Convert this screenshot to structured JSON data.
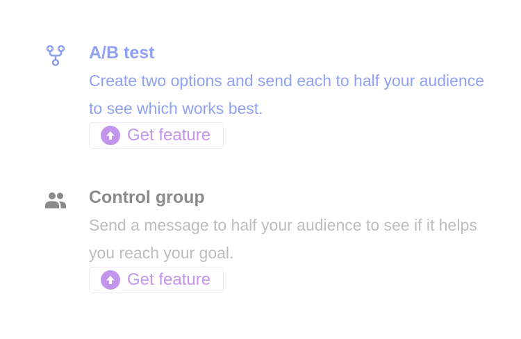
{
  "colors": {
    "accent_blue": "#8fa1f2",
    "accent_purple": "#c394ec",
    "title_gray": "#8a8a8a",
    "desc_gray": "#bdbdbd"
  },
  "features": [
    {
      "icon": "fork-icon",
      "title": "A/B test",
      "description": "Create two options and send each to half your audience to see which works best.",
      "button_label": "Get feature",
      "button_icon": "upgrade-arrow-icon"
    },
    {
      "icon": "people-icon",
      "title": "Control group",
      "description": "Send a message to half your audience to see if it helps you reach your goal.",
      "button_label": "Get feature",
      "button_icon": "upgrade-arrow-icon"
    }
  ]
}
